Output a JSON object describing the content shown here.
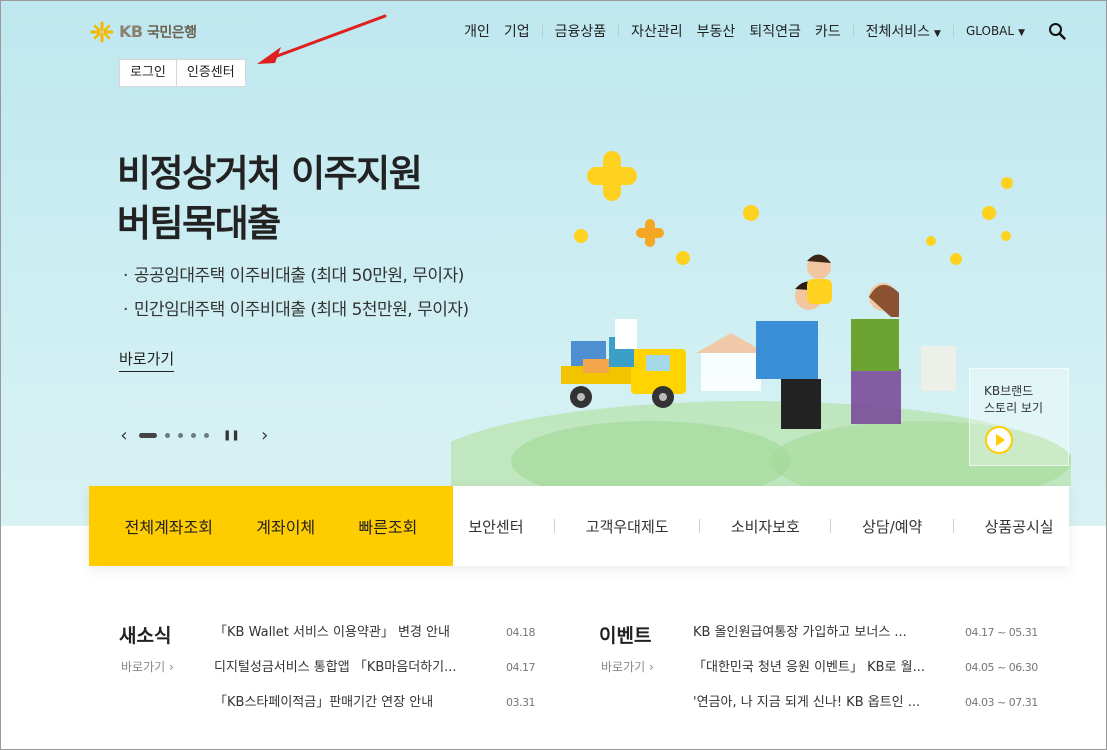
{
  "header": {
    "logo_kb": "KB",
    "logo_name": "국민은행",
    "nav": [
      "개인",
      "기업",
      "금융상품",
      "자산관리",
      "부동산",
      "퇴직연금",
      "카드",
      "전체서비스",
      "GLOBAL"
    ],
    "login": "로그인",
    "cert_center": "인증센터"
  },
  "hero": {
    "title_line1": "비정상거처 이주지원",
    "title_line2": "버팀목대출",
    "bullets": [
      "공공임대주택 이주비대출 (최대 50만원, 무이자)",
      "민간임대주택 이주비대출 (최대 5천만원, 무이자)"
    ],
    "link": "바로가기",
    "brand_story_line1": "KB브랜드",
    "brand_story_line2": "스토리 보기"
  },
  "colors": {
    "accent": "#ffcc00",
    "hero_bg": "#c9ecf2",
    "annotation_arrow": "#e02020"
  },
  "quick": {
    "primary": [
      "전체계좌조회",
      "계좌이체",
      "빠른조회"
    ],
    "secondary": [
      "보안센터",
      "고객우대제도",
      "소비자보호",
      "상담/예약",
      "상품공시실"
    ]
  },
  "news": {
    "title": "새소식",
    "more": "바로가기",
    "items": [
      {
        "text": "「KB Wallet 서비스 이용약관」 변경 안내",
        "date": "04.18"
      },
      {
        "text": "디지털성금서비스 통합앱 「KB마음더하기...",
        "date": "04.17"
      },
      {
        "text": "「KB스타페이적금」판매기간 연장 안내",
        "date": "03.31"
      }
    ]
  },
  "events": {
    "title": "이벤트",
    "more": "바로가기",
    "items": [
      {
        "text": "KB 올인원급여통장 가입하고 보너스 ...",
        "date": "04.17 ~ 05.31"
      },
      {
        "text": "「대한민국 청년 응원 이벤트」 KB로 월...",
        "date": "04.05 ~ 06.30"
      },
      {
        "text": "'연금아, 나 지금 되게 신나! KB 옵트인 ...",
        "date": "04.03 ~ 07.31"
      }
    ]
  }
}
